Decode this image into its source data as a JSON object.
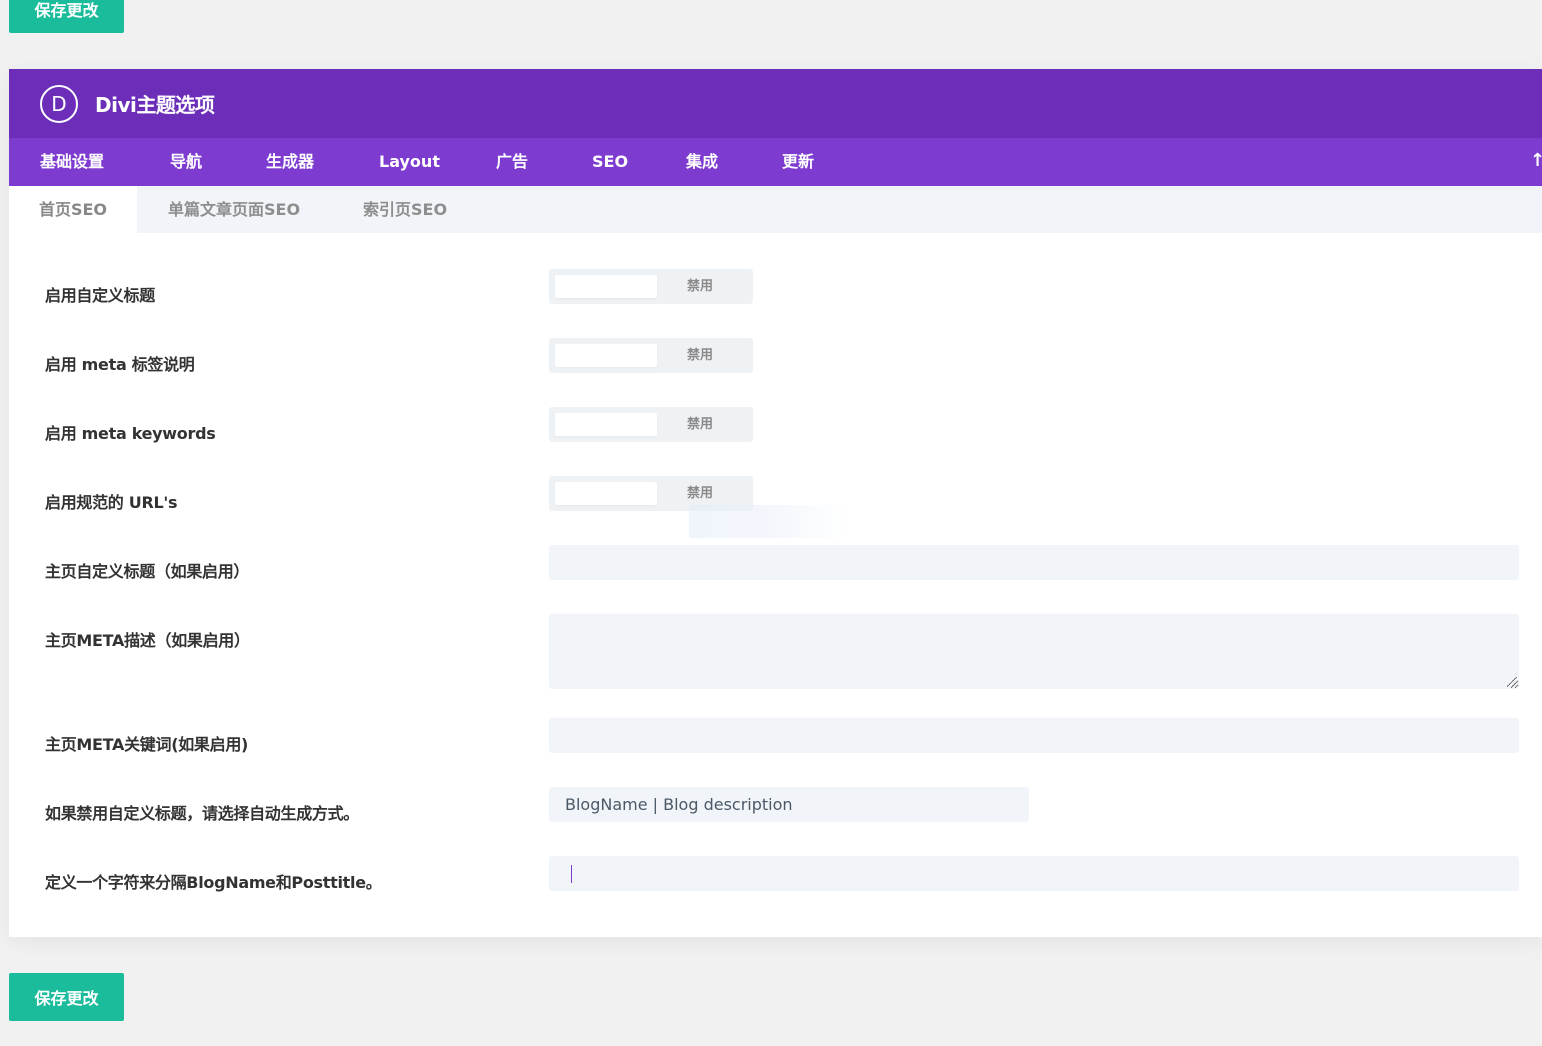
{
  "save_label": "保存更改",
  "header": {
    "logo_letter": "D",
    "title": "Divi主题选项"
  },
  "main_tabs": [
    {
      "label": "基础设置"
    },
    {
      "label": "导航"
    },
    {
      "label": "生成器"
    },
    {
      "label": "Layout"
    },
    {
      "label": "广告"
    },
    {
      "label": "SEO"
    },
    {
      "label": "集成"
    },
    {
      "label": "更新"
    }
  ],
  "up_arrow": "↑",
  "sub_tabs": [
    {
      "label": "首页SEO",
      "active": true
    },
    {
      "label": "单篇文章页面SEO",
      "active": false
    },
    {
      "label": "索引页SEO",
      "active": false
    }
  ],
  "rows": {
    "custom_title": {
      "label": "启用自定义标题",
      "state": "禁用"
    },
    "meta_desc": {
      "label": "启用 meta 标签说明",
      "state": "禁用"
    },
    "meta_keywords": {
      "label": "启用 meta keywords",
      "state": "禁用"
    },
    "canonical": {
      "label": "启用规范的 URL's",
      "state": "禁用"
    },
    "home_title": {
      "label": "主页自定义标题（如果启用）",
      "value": ""
    },
    "home_meta_desc": {
      "label": "主页META描述（如果启用）",
      "value": ""
    },
    "home_meta_keywords": {
      "label": "主页META关键词(如果启用)",
      "value": ""
    },
    "auto_title": {
      "label": "如果禁用自定义标题，请选择自动生成方式。",
      "value": "BlogName | Blog description"
    },
    "separator": {
      "label": "定义一个字符来分隔BlogName和Posttitle。",
      "value": ""
    }
  }
}
